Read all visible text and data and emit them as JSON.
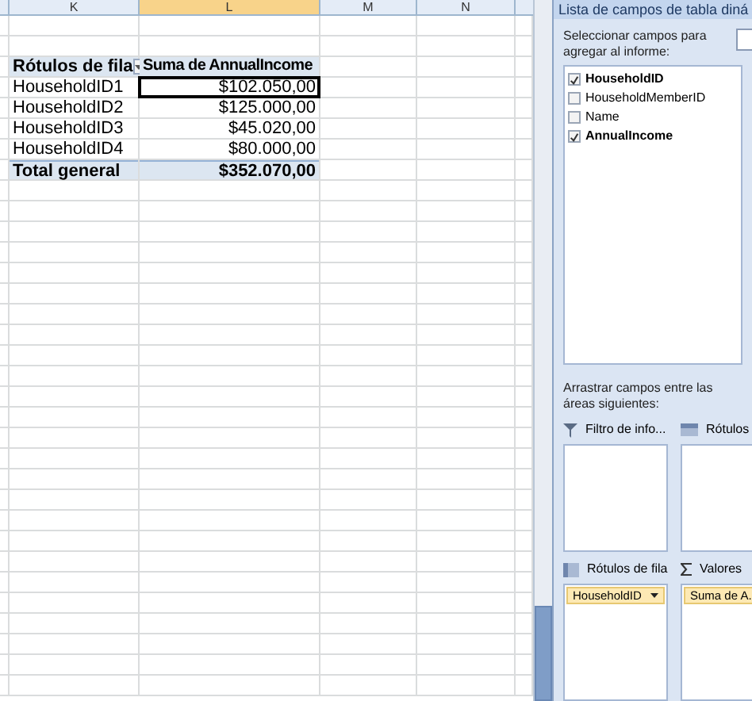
{
  "sheet": {
    "columns": [
      {
        "label": "K",
        "selected": false
      },
      {
        "label": "L",
        "selected": true
      },
      {
        "label": "M",
        "selected": false
      },
      {
        "label": "N",
        "selected": false
      }
    ],
    "pivot": {
      "header_label": "Rótulos de fila",
      "header_value": "Suma de AnnualIncome",
      "rows": [
        {
          "label": "HouseholdID1",
          "value": "$102.050,00",
          "selected": true
        },
        {
          "label": "HouseholdID2",
          "value": "$125.000,00",
          "selected": false
        },
        {
          "label": "HouseholdID3",
          "value": "$45.020,00",
          "selected": false
        },
        {
          "label": "HouseholdID4",
          "value": "$80.000,00",
          "selected": false
        }
      ],
      "total_label": "Total general",
      "total_value": "$352.070,00"
    }
  },
  "panel": {
    "title": "Lista de campos de tabla diná",
    "instruction": "Seleccionar campos para agregar al informe:",
    "fields": [
      {
        "label": "HouseholdID",
        "checked": true
      },
      {
        "label": "HouseholdMemberID",
        "checked": false
      },
      {
        "label": "Name",
        "checked": false
      },
      {
        "label": "AnnualIncome",
        "checked": true
      }
    ],
    "areas_instruction": "Arrastrar campos entre las áreas siguientes:",
    "areas": [
      {
        "kind": "filter",
        "label": "Filtro de info..."
      },
      {
        "kind": "columns",
        "label": "Rótulos"
      },
      {
        "kind": "rows",
        "label": "Rótulos de fila",
        "chip": "HouseholdID"
      },
      {
        "kind": "values",
        "label": "Valores",
        "chip": "Suma de A."
      }
    ]
  }
}
